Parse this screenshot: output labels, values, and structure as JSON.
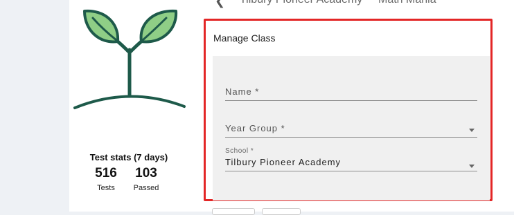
{
  "top_bar": {
    "back_icon": "chevron-left-icon",
    "school": "Tilbury Pioneer Academy",
    "user": "Math Mania"
  },
  "stats": {
    "title": "Test stats (7 days)",
    "tests_value": "516",
    "tests_label": "Tests",
    "passed_value": "103",
    "passed_label": "Passed"
  },
  "manage_class": {
    "title": "Manage Class",
    "name_placeholder": "Name *",
    "year_group_placeholder": "Year Group *",
    "school_label": "School *",
    "school_value": "Tilbury Pioneer Academy"
  },
  "colors": {
    "highlight": "#e32626",
    "leaf_fill": "#8fce86",
    "outline": "#1e5a4a"
  }
}
